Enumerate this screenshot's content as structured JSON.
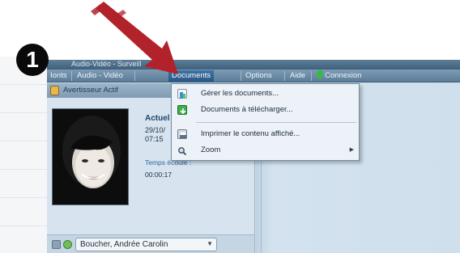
{
  "callout_number": "1",
  "window": {
    "title": "Audio-Vidéo - Surveill"
  },
  "menubar": {
    "items": [
      {
        "label": "Ionts"
      },
      {
        "label": "Audio - Vidéo"
      },
      {
        "label": "Documents"
      },
      {
        "label": "Options"
      },
      {
        "label": "Aide"
      },
      {
        "label": "Connexion"
      }
    ]
  },
  "left_panel": {
    "header": "Avertisseur Actif",
    "status": {
      "title": "Actuel",
      "line1": "29/10/",
      "line2": "07:15",
      "time_label": "Temps écoulé :",
      "time_value": "00:00:17"
    },
    "user_select_value": "Boucher, Andrée Carolin"
  },
  "documents_menu": {
    "items": [
      {
        "label": "Gérer les documents...",
        "icon": "document-manage-icon"
      },
      {
        "label": "Documents à télécharger...",
        "icon": "download-icon"
      },
      {
        "label": "Imprimer le contenu affiché...",
        "icon": "printer-icon"
      },
      {
        "label": "Zoom",
        "icon": "magnifier-icon",
        "submenu": true
      }
    ]
  },
  "colors": {
    "arrow": "#b1222a",
    "menu_active": "#2a5785",
    "connection_indicator": "#2fc03a"
  }
}
